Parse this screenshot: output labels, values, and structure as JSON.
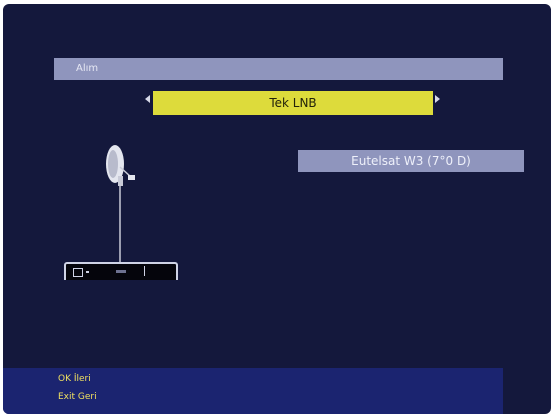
{
  "header": {
    "title": "Alım"
  },
  "lnb": {
    "value": "Tek LNB"
  },
  "satellite": {
    "name": "Eutelsat W3 (7°0 D)"
  },
  "footer": {
    "ok_hint": "OK İleri",
    "exit_hint": "Exit Geri"
  },
  "colors": {
    "background": "#14183c",
    "bar": "#8f95bd",
    "selection": "#dddb3b",
    "footer": "#1b2470",
    "hint_text": "#f0e060"
  },
  "icons": [
    "arrow-left-icon",
    "arrow-right-icon",
    "satellite-dish-icon",
    "receiver-icon"
  ]
}
